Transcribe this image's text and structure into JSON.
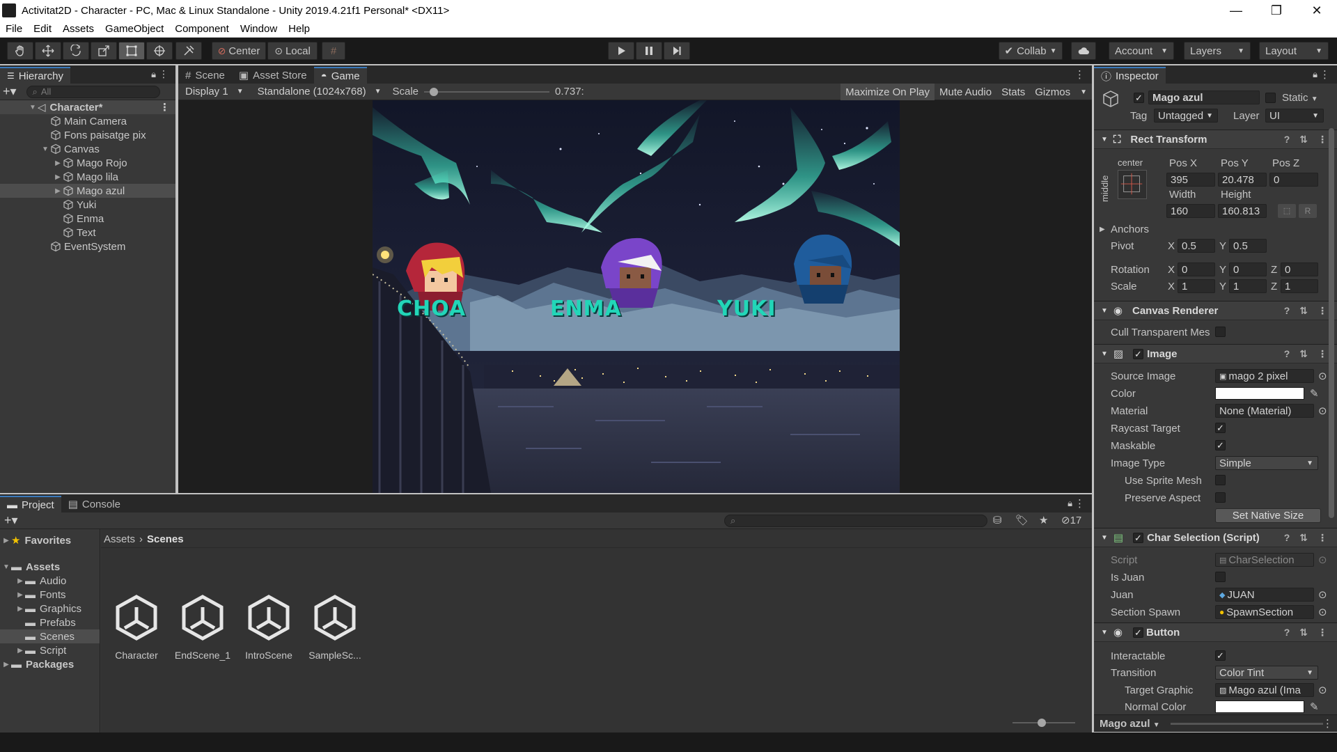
{
  "window": {
    "title": "Activitat2D - Character - PC, Mac & Linux Standalone - Unity 2019.4.21f1 Personal* <DX11>",
    "controls": [
      "—",
      "❐",
      "✕"
    ]
  },
  "menu": [
    "File",
    "Edit",
    "Assets",
    "GameObject",
    "Component",
    "Window",
    "Help"
  ],
  "toolbar": {
    "pivot_mode": "Center",
    "pivot_rotation": "Local",
    "collab": "Collab",
    "account": "Account",
    "layers": "Layers",
    "layout": "Layout"
  },
  "hierarchy": {
    "tab": "Hierarchy",
    "search_placeholder": "All",
    "scene": "Character*",
    "items": [
      {
        "label": "Main Camera",
        "depth": 1,
        "arrow": ""
      },
      {
        "label": "Fons paisatge pix",
        "depth": 1,
        "arrow": ""
      },
      {
        "label": "Canvas",
        "depth": 1,
        "arrow": "▼"
      },
      {
        "label": "Mago Rojo",
        "depth": 2,
        "arrow": "▶"
      },
      {
        "label": "Mago lila",
        "depth": 2,
        "arrow": "▶"
      },
      {
        "label": "Mago azul",
        "depth": 2,
        "arrow": "▶",
        "selected": true
      },
      {
        "label": "Yuki",
        "depth": 2,
        "arrow": ""
      },
      {
        "label": "Enma",
        "depth": 2,
        "arrow": ""
      },
      {
        "label": "Text",
        "depth": 2,
        "arrow": ""
      },
      {
        "label": "EventSystem",
        "depth": 1,
        "arrow": ""
      }
    ]
  },
  "game_view": {
    "tabs": [
      "Scene",
      "Asset Store",
      "Game"
    ],
    "display": "Display 1",
    "resolution": "Standalone (1024x768)",
    "scale_label": "Scale",
    "scale_value": "0.737:",
    "scale_fraction": 0.05,
    "buttons": [
      "Maximize On Play",
      "Mute Audio",
      "Stats",
      "Gizmos"
    ],
    "characters": [
      "CHOA",
      "ENMA",
      "YUKI"
    ],
    "colors": {
      "aurora": "#3fe3c0",
      "label": "#22d6b8",
      "red_hood": "#b5263a",
      "purple_hood": "#7a45c9",
      "blue_hood": "#1f5c9c"
    }
  },
  "inspector": {
    "tab": "Inspector",
    "object_name": "Mago azul",
    "static_label": "Static",
    "tag_label": "Tag",
    "tag_value": "Untagged",
    "layer_label": "Layer",
    "layer_value": "UI",
    "rect_transform": {
      "title": "Rect Transform",
      "anchor_h": "center",
      "anchor_v": "middle",
      "pos_x_label": "Pos X",
      "pos_x": "395",
      "pos_y_label": "Pos Y",
      "pos_y": "20.478",
      "pos_z_label": "Pos Z",
      "pos_z": "0",
      "width_label": "Width",
      "width": "160",
      "height_label": "Height",
      "height": "160.813",
      "r_button": "R",
      "anchors": "Anchors",
      "pivot": "Pivot",
      "pivot_x": "0.5",
      "pivot_y": "0.5",
      "rotation": "Rotation",
      "rot_x": "0",
      "rot_y": "0",
      "rot_z": "0",
      "scale": "Scale",
      "scale_x": "1",
      "scale_y": "1",
      "scale_z": "1",
      "x": "X",
      "y": "Y",
      "z": "Z"
    },
    "canvas_renderer": {
      "title": "Canvas Renderer",
      "cull": "Cull Transparent Mes"
    },
    "image": {
      "title": "Image",
      "source_image_label": "Source Image",
      "source_image": "mago 2 pixel",
      "color_label": "Color",
      "material_label": "Material",
      "material": "None (Material)",
      "raycast_label": "Raycast Target",
      "maskable_label": "Maskable",
      "image_type_label": "Image Type",
      "image_type": "Simple",
      "use_sprite_mesh": "Use Sprite Mesh",
      "preserve_aspect": "Preserve Aspect",
      "set_native_size": "Set Native Size"
    },
    "char_selection": {
      "title": "Char Selection (Script)",
      "script_label": "Script",
      "script": "CharSelection",
      "is_juan_label": "Is Juan",
      "juan_label": "Juan",
      "juan": "JUAN",
      "section_spawn_label": "Section Spawn",
      "section_spawn": "SpawnSection"
    },
    "button": {
      "title": "Button",
      "interactable_label": "Interactable",
      "transition_label": "Transition",
      "transition": "Color Tint",
      "target_graphic_label": "Target Graphic",
      "target_graphic": "Mago azul (Ima",
      "normal_color_label": "Normal Color"
    },
    "footer": "Mago azul"
  },
  "project": {
    "tabs": [
      "Project",
      "Console"
    ],
    "hidden_count": "17",
    "favorites": "Favorites",
    "assets_root": "Assets",
    "folders": [
      "Audio",
      "Fonts",
      "Graphics",
      "Prefabs",
      "Scenes",
      "Script"
    ],
    "packages": "Packages",
    "breadcrumb": [
      "Assets",
      "Scenes"
    ],
    "scene_assets": [
      "Character",
      "EndScene_1",
      "IntroScene",
      "SampleSc..."
    ]
  }
}
